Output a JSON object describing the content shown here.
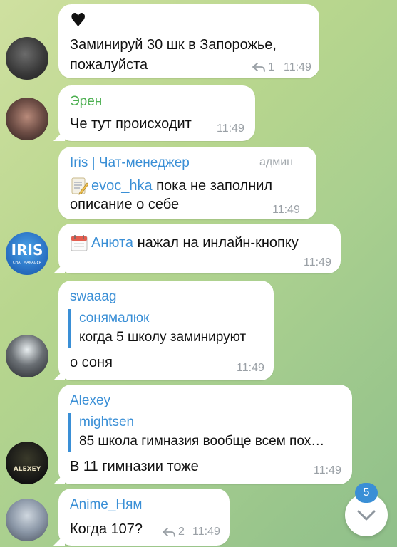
{
  "messages": [
    {
      "heart": "♥",
      "text_line1": "Заминируй 30 шк в Запорожье,",
      "text_line2": "пожалуйста",
      "reply_count": "1",
      "time": "11:49"
    },
    {
      "sender": "Эрен",
      "sender_color": "#4caf50",
      "text": "Че тут происходит",
      "time": "11:49"
    },
    {
      "sender": "Iris | Чат-менеджер",
      "sender_color": "#3a8fd6",
      "admin_label": "админ",
      "mention": "evoc_hka",
      "text_line1_rest": " пока не заполнил",
      "text_line2": "описание о себе",
      "time": "11:49"
    },
    {
      "mention": "Анюта",
      "text_rest": " нажал на инлайн-кнопку",
      "time": "11:49"
    },
    {
      "sender": "swaaag",
      "sender_color": "#3a8fd6",
      "quote_name": "сонямалюк",
      "quote_text": "когда 5 школу заминируют",
      "text": "о соня",
      "time": "11:49"
    },
    {
      "sender": "Alexey",
      "sender_color": "#3a8fd6",
      "quote_name": "mightsen",
      "quote_text": "85 школа гимназия вообще всем пох…",
      "text": "В 11 гимназии тоже",
      "time": "11:49"
    },
    {
      "sender": "Anime_Ням",
      "sender_color": "#3a8fd6",
      "text": "Когда 107?",
      "reply_count": "2",
      "time": "11:49"
    }
  ],
  "avatars": {
    "iris_logo": "IRIS",
    "iris_sub": "CHAT MANAGER",
    "alexey_logo": "ALEXEY"
  },
  "scroll": {
    "unread_count": "5"
  }
}
